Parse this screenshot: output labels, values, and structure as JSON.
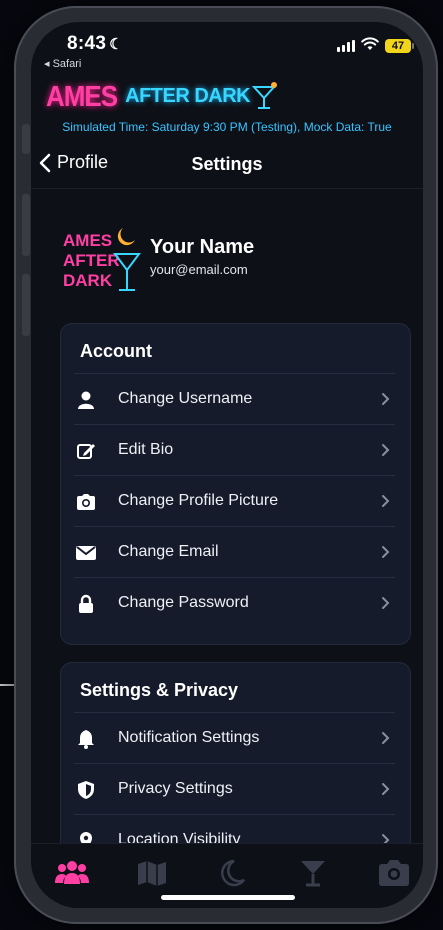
{
  "status_bar": {
    "time": "8:43",
    "back_app": "◂ Safari",
    "battery": "47"
  },
  "header": {
    "logo_ames": "AMES",
    "logo_after_dark": "AFTER DARK",
    "sim_text": "Simulated Time: Saturday 9:30 PM (Testing), Mock Data: True",
    "back_label": "Profile",
    "title": "Settings"
  },
  "profile": {
    "avatar_lines": [
      "AMES",
      "AFTER",
      "DARK"
    ],
    "name": "Your Name",
    "email": "your@email.com"
  },
  "account": {
    "title": "Account",
    "items": [
      {
        "label": "Change Username",
        "icon": "user-icon"
      },
      {
        "label": "Edit Bio",
        "icon": "edit-icon"
      },
      {
        "label": "Change Profile Picture",
        "icon": "camera-icon"
      },
      {
        "label": "Change Email",
        "icon": "envelope-icon"
      },
      {
        "label": "Change Password",
        "icon": "lock-icon"
      }
    ]
  },
  "privacy": {
    "title": "Settings & Privacy",
    "items": [
      {
        "label": "Notification Settings",
        "icon": "bell-icon"
      },
      {
        "label": "Privacy Settings",
        "icon": "shield-icon"
      },
      {
        "label": "Location Visibility",
        "icon": "location-pin-icon"
      }
    ]
  },
  "tabs": [
    {
      "name": "friends",
      "icon": "users-icon",
      "active": true
    },
    {
      "name": "map",
      "icon": "map-icon",
      "active": false
    },
    {
      "name": "night",
      "icon": "moon-icon",
      "active": false
    },
    {
      "name": "bars",
      "icon": "cocktail-icon",
      "active": false
    },
    {
      "name": "camera",
      "icon": "camera-icon",
      "active": false
    }
  ],
  "colors": {
    "accent_pink": "#ff3fa4",
    "accent_cyan": "#38c4ff",
    "card_bg": "#151b2a",
    "screen_bg": "#0e1017"
  }
}
